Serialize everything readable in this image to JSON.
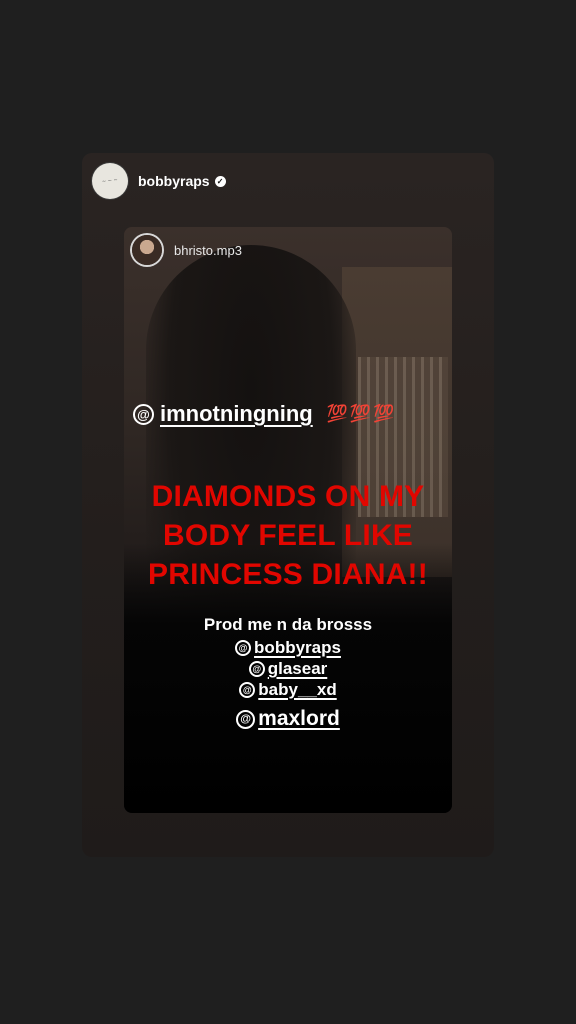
{
  "story": {
    "author": {
      "username": "bobbyraps",
      "verified_icon": "verified-badge-icon"
    },
    "repost": {
      "username": "bhristo.mp3"
    },
    "overlay": {
      "main_tag": "imnotningning",
      "emoji": "💯💯💯",
      "headline_lines": [
        "DIAMONDS ON MY",
        "BODY FEEL LIKE",
        "PRINCESS DIANA!!"
      ],
      "prod_text": "Prod me n da brosss",
      "credits": [
        "bobbyraps",
        "glasear",
        "baby__xd",
        "maxlord"
      ]
    }
  },
  "colors": {
    "background": "#1f1f1f",
    "headline": "#e10600",
    "emoji": "#c1121f"
  }
}
